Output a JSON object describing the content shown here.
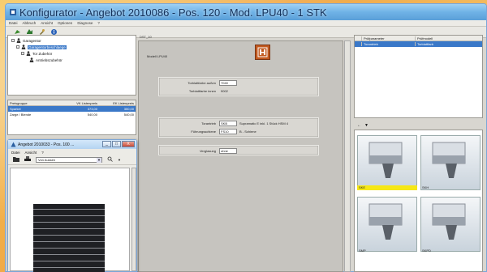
{
  "window": {
    "title": "Konfigurator - Angebot 2010086 - Pos. 120 - Mod. LPU40 - 1 STK"
  },
  "menu": [
    "Datei",
    "Abbruch",
    "Ansicht",
    "Optionen",
    "Diagnose",
    "?"
  ],
  "toolbar_icons": [
    "new-icon",
    "open-icon",
    "tools-icon",
    "info-icon"
  ],
  "tree": [
    {
      "label": "Garagentor"
    },
    {
      "label": "Garagentorbeschlaege",
      "selected": true
    },
    {
      "label": "Tor Zubehör"
    },
    {
      "label": "Antriebszubehör"
    }
  ],
  "price_table": {
    "headers": [
      "Preisgruppe",
      "VK Listenpreis",
      "EK Listenpreis"
    ],
    "rows": [
      {
        "cells": [
          "Sparkel",
          "373,00",
          "350,00"
        ],
        "selected": true
      },
      {
        "cells": [
          "Zarge / Blende",
          "540,00",
          "540,00"
        ],
        "selected": false
      }
    ]
  },
  "center": {
    "header": "DST_10",
    "model_label": "Modell LPU40",
    "fields": [
      {
        "label": "Torblattfarbe außen",
        "value": "7040",
        "note": ""
      },
      {
        "label": "Torblattfarbe innen",
        "value": "9002",
        "note": ""
      },
      {
        "label": "Torantrieb",
        "value": "SKB",
        "note": "Supramatic E inkl. 1 Stück HSM 4"
      },
      {
        "label": "Führungsschiene",
        "value": "FS10",
        "note": "B - Schiene"
      },
      {
        "label": "Verglasung",
        "value": "ohne",
        "note": ""
      }
    ]
  },
  "right_table": {
    "headers": [
      "",
      "Prüfparameter",
      "Prüfmodell"
    ],
    "rows": [
      {
        "cells": [
          "",
          "Torantrieb",
          "Torblattfarb"
        ],
        "selected": true
      }
    ]
  },
  "gallery": {
    "items": [
      {
        "caption": "SKE",
        "selected": true
      },
      {
        "caption": "SKH",
        "selected": false
      },
      {
        "caption": "SMP",
        "selected": false
      },
      {
        "caption": "SKPD",
        "selected": false
      }
    ]
  },
  "sub_window": {
    "title": "Angebot 2010033 - Pos. 100 ...",
    "menu": [
      "Datei",
      "Ansicht",
      "?"
    ],
    "view_select": "Von Aussen",
    "buttons": [
      "_",
      "□",
      "X"
    ]
  },
  "colors": {
    "selection": "#3a78c8",
    "title_blue": "#6fb2e6",
    "door": "#1f2024",
    "highlight_yellow": "#f6e716"
  }
}
